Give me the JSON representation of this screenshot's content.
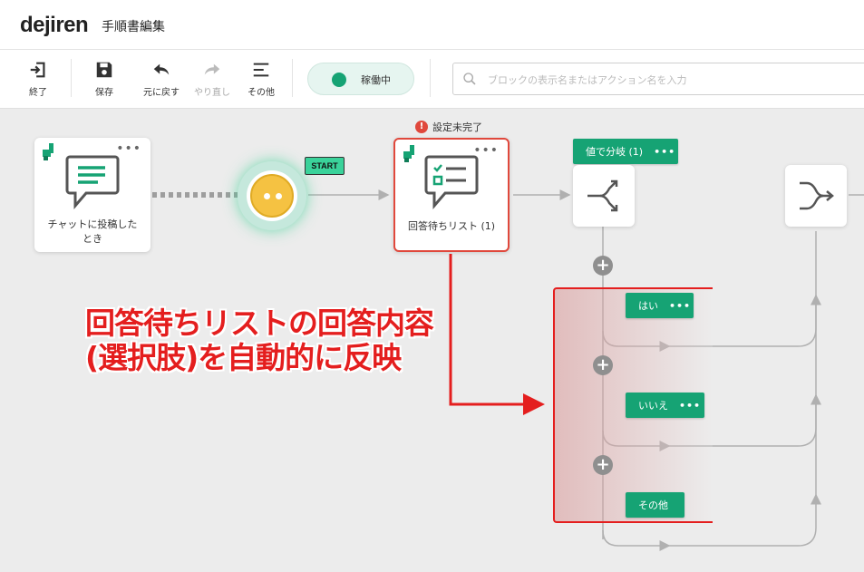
{
  "app": {
    "logo": "dejiren",
    "page_title": "手順書編集"
  },
  "toolbar": {
    "exit_label": "終了",
    "save_label": "保存",
    "undo_label": "元に戻す",
    "redo_label": "やり直し",
    "other_label": "その他",
    "status_label": "稼働中"
  },
  "search": {
    "placeholder": "ブロックの表示名またはアクション名を入力",
    "value": ""
  },
  "canvas": {
    "trigger_node": {
      "label_line1": "チャットに投稿した",
      "label_line2": "とき",
      "menu": "•••"
    },
    "start_badge": "START",
    "warning": {
      "icon": "!",
      "text": "設定未完了"
    },
    "answer_list_node": {
      "label": "回答待ちリスト (1)",
      "menu": "•••"
    },
    "branch_header": {
      "label": "値で分岐 (1)",
      "menu": "•••"
    },
    "branch_options": [
      {
        "label": "はい",
        "menu": "•••"
      },
      {
        "label": "いいえ",
        "menu": "•••"
      },
      {
        "label": "その他",
        "menu": ""
      }
    ],
    "add_symbol": "+",
    "annotation": {
      "line1": "回答待ちリストの回答内容",
      "line2": "(選択肢)を自動的に反映"
    }
  },
  "colors": {
    "accent": "#16a374",
    "warning": "#e0483c",
    "annotation": "#e41e1e"
  },
  "icons": [
    "exit-icon",
    "save-icon",
    "undo-icon",
    "redo-icon",
    "menu-icon",
    "search-icon",
    "chat-icon",
    "checklist-icon",
    "branch-icon",
    "merge-icon",
    "plus-icon"
  ]
}
